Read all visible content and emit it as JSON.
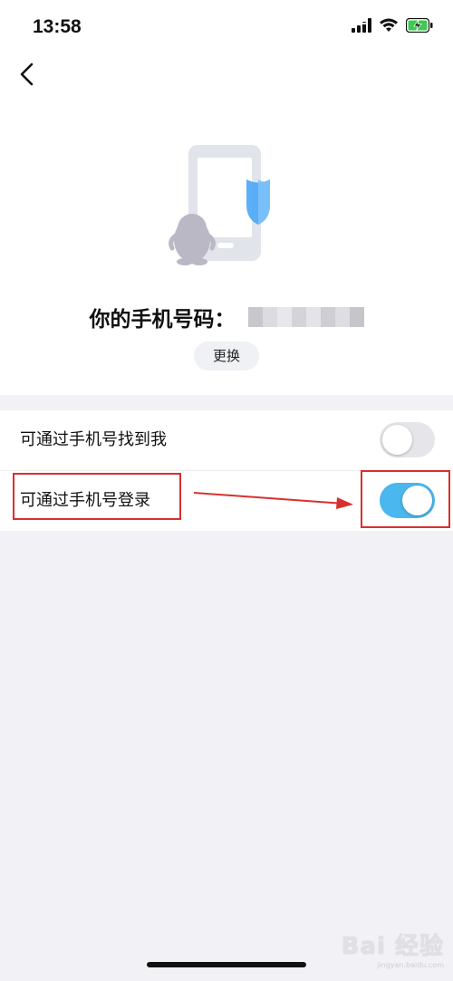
{
  "status_bar": {
    "time": "13:58",
    "icons": [
      "cellular-signal-icon",
      "wifi-icon",
      "battery-charging-icon"
    ]
  },
  "nav": {
    "back_icon": "chevron-left-icon"
  },
  "hero": {
    "illustration": "phone-shield-penguin-illustration",
    "colors": {
      "phone": "#e4e6ee",
      "shield": "#4aa6f5",
      "penguin": "#b9b8c4"
    }
  },
  "phone_section": {
    "label": "你的手机号码：",
    "change_button": "更换"
  },
  "settings": [
    {
      "label": "可通过手机号找到我",
      "enabled": false
    },
    {
      "label": "可通过手机号登录",
      "enabled": true
    }
  ],
  "colors": {
    "toggle_on": "#4ab7ee",
    "toggle_off": "#e6e6ea",
    "annotation_red": "#d9302e",
    "page_bg": "#f2f2f6"
  },
  "watermark": {
    "logo": "Bai 经验",
    "url": "jingyan.baidu.com"
  }
}
